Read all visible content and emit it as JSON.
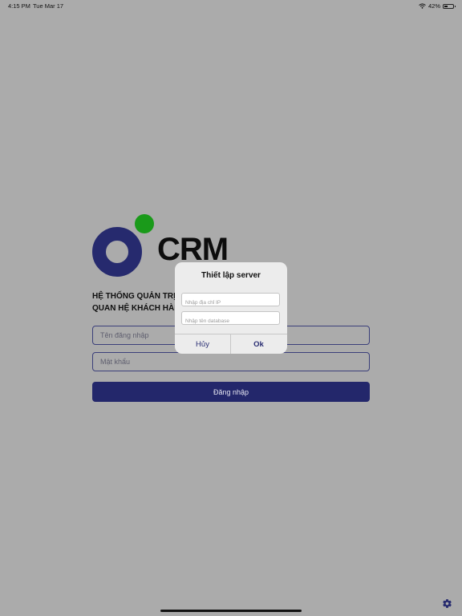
{
  "status_bar": {
    "time": "4:15 PM",
    "date": "Tue Mar 17",
    "battery": "42%",
    "battery_level": 0.42
  },
  "logo": {
    "text": "CRM",
    "ring_color": "#262a6e",
    "dot_color": "#1a9a1a"
  },
  "tagline": {
    "line1": "HỆ THỐNG QUẢN TRỊ",
    "line2": "QUAN HỆ KHÁCH HÀNG"
  },
  "login_form": {
    "username_placeholder": "Tên đăng nhập",
    "password_placeholder": "Mật khẩu",
    "submit_label": "Đăng nhập"
  },
  "dialog": {
    "title": "Thiết lập server",
    "ip_placeholder": "Nhập địa chỉ IP",
    "database_placeholder": "Nhập tên database",
    "cancel_label": "Hủy",
    "ok_label": "Ok"
  },
  "colors": {
    "primary": "#23276b",
    "background": "#ababab",
    "dialog": "#ececec"
  },
  "icons": {
    "settings": "gear-icon",
    "wifi": "wifi-icon",
    "battery": "battery-icon"
  }
}
